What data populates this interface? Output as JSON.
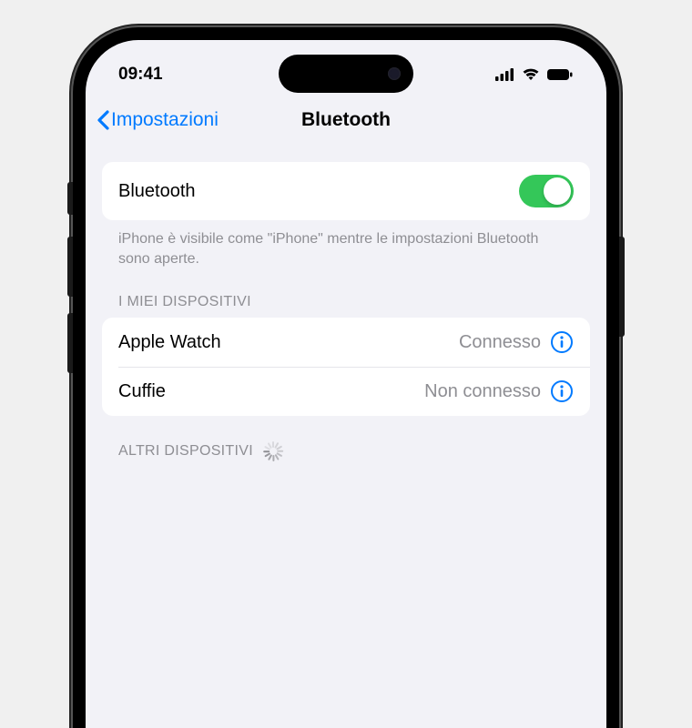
{
  "status_bar": {
    "time": "09:41"
  },
  "nav": {
    "back_label": "Impostazioni",
    "title": "Bluetooth"
  },
  "bluetooth_toggle": {
    "label": "Bluetooth",
    "on": true
  },
  "visibility_note": "iPhone è visibile come \"iPhone\" mentre le impostazioni Bluetooth sono aperte.",
  "sections": {
    "my_devices_header": "I MIEI DISPOSITIVI",
    "other_devices_header": "ALTRI DISPOSITIVI"
  },
  "my_devices": [
    {
      "name": "Apple Watch",
      "status": "Connesso"
    },
    {
      "name": "Cuffie",
      "status": "Non connesso"
    }
  ],
  "colors": {
    "accent": "#007aff",
    "toggle_on": "#34c759",
    "secondary": "#8e8e93",
    "bg": "#f2f2f7"
  }
}
